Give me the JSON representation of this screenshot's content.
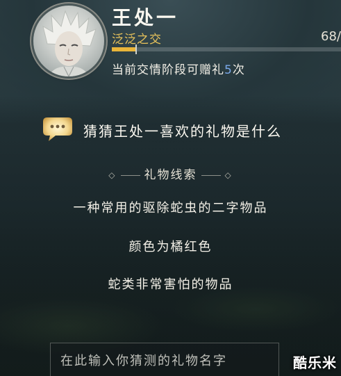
{
  "character": {
    "name": "王处一",
    "relation_stage": "泛泛之交",
    "progress_text": "68/",
    "progress_fraction": 0.11,
    "gift_times_prefix": "当前交情阶段可赠礼",
    "gift_times_count": "5",
    "gift_times_suffix": "次"
  },
  "quiz": {
    "question": "猜猜王处一喜欢的礼物是什么",
    "clue_title": "礼物线索",
    "clues": [
      "一种常用的驱除蛇虫的二字物品",
      "颜色为橘红色",
      "蛇类非常害怕的物品"
    ]
  },
  "input": {
    "placeholder": "在此输入你猜测的礼物名字"
  },
  "watermark": "酷乐米",
  "colors": {
    "relation": "#e8c35b",
    "progress_fill": "#e9b53a",
    "count_highlight": "#7aa9ea"
  },
  "icons": {
    "bubble": "chat-bubble-icon",
    "avatar": "character-portrait"
  }
}
